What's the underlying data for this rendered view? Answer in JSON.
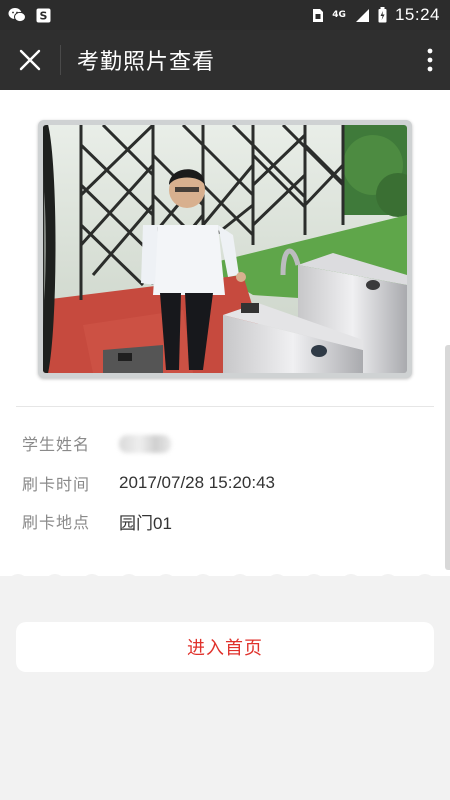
{
  "status_bar": {
    "time": "15:24",
    "network": "4G",
    "icons": [
      "wechat-icon",
      "s-app-icon",
      "sim-icon",
      "signal-icon",
      "battery-icon"
    ]
  },
  "header": {
    "title": "考勤照片查看",
    "close_icon": "close-icon",
    "more_icon": "more-vertical-icon"
  },
  "record": {
    "name_label": "学生姓名",
    "name_value": "",
    "time_label": "刷卡时间",
    "time_value": "2017/07/28 15:20:43",
    "location_label": "刷卡地点",
    "location_value": "园门01"
  },
  "actions": {
    "home_label": "进入首页"
  },
  "colors": {
    "header_bg": "#2f2f2f",
    "status_bg": "#2c2c2c",
    "accent": "#e0322c",
    "page_bg": "#f2f2f2"
  }
}
